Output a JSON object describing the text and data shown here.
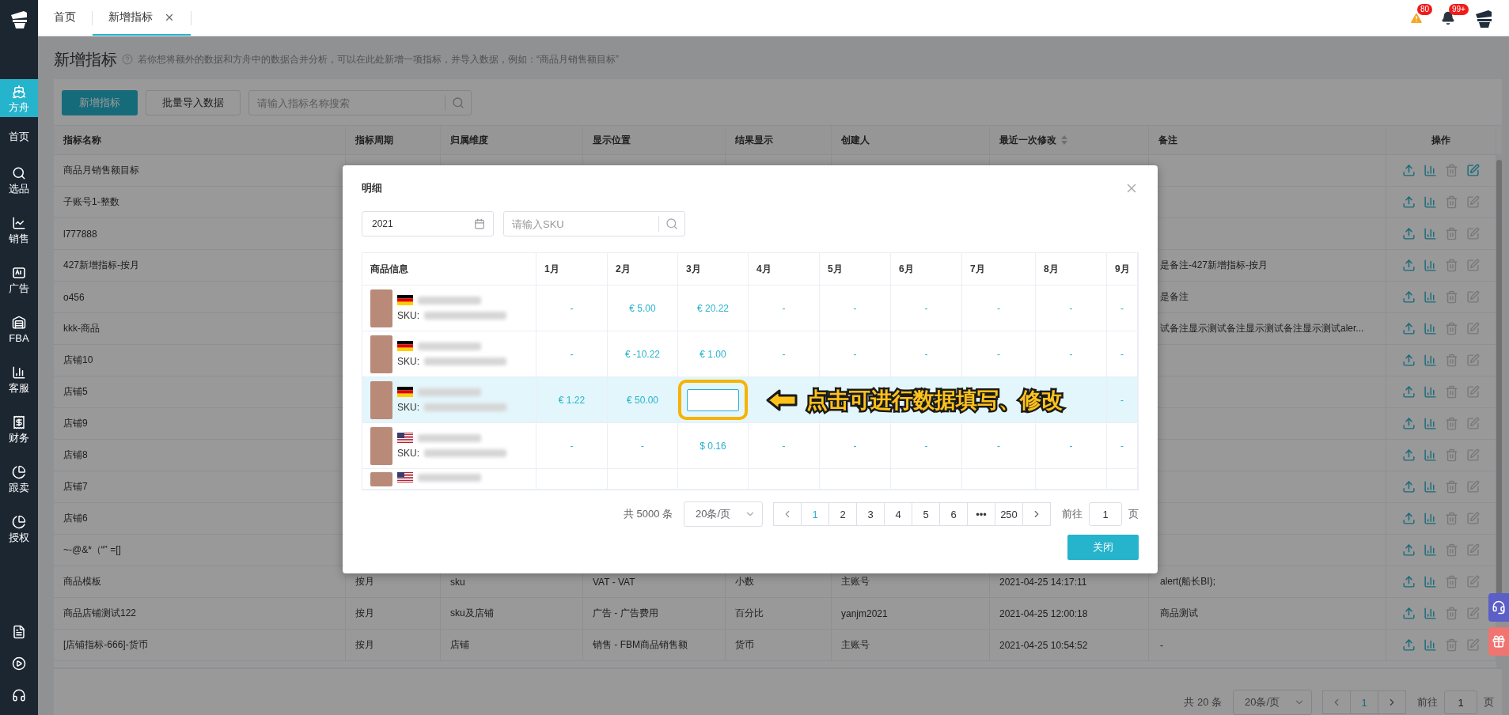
{
  "topbar": {
    "tabs": [
      {
        "label": "首页",
        "selected": false,
        "closable": false
      },
      {
        "label": "新增指标",
        "selected": true,
        "closable": true
      }
    ],
    "warning_count": "80",
    "notification_count": "99+"
  },
  "sidebar": {
    "items": [
      {
        "label": "方舟",
        "selected": true
      },
      {
        "label": "首页",
        "selected": false
      },
      {
        "label": "选品",
        "selected": false
      },
      {
        "label": "销售",
        "selected": false
      },
      {
        "label": "广告",
        "selected": false
      },
      {
        "label": "FBA",
        "selected": false
      },
      {
        "label": "客服",
        "selected": false
      },
      {
        "label": "财务",
        "selected": false
      },
      {
        "label": "跟卖",
        "selected": false
      },
      {
        "label": "授权",
        "selected": false
      }
    ]
  },
  "page": {
    "title": "新增指标",
    "description": "若你想将额外的数据和方舟中的数据合并分析，可以在此处新增一项指标，并导入数据，例如：“商品月销售额目标”",
    "toolbar": {
      "primary_button": "新增指标",
      "import_button": "批量导入数据",
      "search": {
        "placeholder": "请输入指标名称搜索"
      }
    }
  },
  "table": {
    "columns": [
      {
        "label": "指标名称",
        "sortable": false
      },
      {
        "label": "指标周期",
        "sortable": false
      },
      {
        "label": "归属维度",
        "sortable": false
      },
      {
        "label": "显示位置",
        "sortable": false
      },
      {
        "label": "结果显示",
        "sortable": false
      },
      {
        "label": "创建人",
        "sortable": false
      },
      {
        "label": "最近一次修改",
        "sortable": true
      },
      {
        "label": "备注",
        "sortable": false
      },
      {
        "label": "操作",
        "sortable": false
      }
    ],
    "rows": [
      {
        "name": "商品月销售额目标",
        "edit_enabled": true,
        "delete_enabled": false
      },
      {
        "name": "子账号1-整数",
        "edit_enabled": false,
        "delete_enabled": false
      },
      {
        "name": "l777888",
        "edit_enabled": false,
        "delete_enabled": false
      },
      {
        "name": "427新增指标-按月",
        "note": "是备注-427新增指标-按月",
        "edit_enabled": false,
        "delete_enabled": false
      },
      {
        "name": "o456",
        "note": "是备注",
        "edit_enabled": false,
        "delete_enabled": false
      },
      {
        "name": "kkk-商品",
        "note": "试备注显示测试备注显示测试备注显示测试aler...",
        "edit_enabled": false,
        "delete_enabled": false
      },
      {
        "name": "店铺10",
        "edit_enabled": false,
        "delete_enabled": false
      },
      {
        "name": "店铺5",
        "edit_enabled": false,
        "delete_enabled": false
      },
      {
        "name": "店铺9",
        "edit_enabled": false,
        "delete_enabled": false
      },
      {
        "name": "店铺8",
        "edit_enabled": false,
        "delete_enabled": false
      },
      {
        "name": "店铺7",
        "edit_enabled": false,
        "delete_enabled": false
      },
      {
        "name": "店铺6",
        "edit_enabled": false,
        "delete_enabled": false
      },
      {
        "name": "~-@&*（“” =[]",
        "edit_enabled": false,
        "delete_enabled": false
      },
      {
        "name": "商品模板",
        "details": [
          "按月",
          "sku",
          "VAT - VAT",
          "小数",
          "主账号",
          "2021-04-25 14:17:11"
        ],
        "note": "alert(船长BI);",
        "edit_enabled": false,
        "delete_enabled": false
      },
      {
        "name": "商品店铺测试122",
        "details": [
          "按月",
          "sku及店铺",
          "广告 - 广告费用",
          "百分比",
          "yanjm2021",
          "2021-04-25 12:00:18"
        ],
        "note": "商品测试",
        "edit_enabled": false,
        "delete_enabled": false
      },
      {
        "name": "[店铺指标-666]-货币",
        "details": [
          "按月",
          "店铺",
          "销售 - FBM商品销售额",
          "货币",
          "主账号",
          "2021-04-25 10:54:52"
        ],
        "note": "-",
        "edit_enabled": false,
        "delete_enabled": false
      }
    ],
    "pagination": {
      "total": "共 20 条",
      "page_size": "20条/页",
      "pages": [
        {
          "label": "1",
          "selected": true
        }
      ],
      "goto_label": "前往",
      "goto_value": "1",
      "page_unit": "页"
    }
  },
  "modal": {
    "title": "明细",
    "year": "2021",
    "sku_search": {
      "placeholder": "请输入SKU"
    },
    "columns": [
      "商品信息",
      "1月",
      "2月",
      "3月",
      "4月",
      "5月",
      "6月",
      "7月",
      "8月",
      "9月"
    ],
    "rows": [
      {
        "kind": "de",
        "selected": false,
        "sku_label": "SKU:",
        "cells": [
          {
            "kind": "text",
            "value": "-"
          },
          {
            "kind": "text",
            "value": "€ 5.00"
          },
          {
            "kind": "text",
            "value": "€ 20.22"
          },
          {
            "kind": "text",
            "value": "-"
          },
          {
            "kind": "text",
            "value": "-"
          },
          {
            "kind": "text",
            "value": "-"
          },
          {
            "kind": "text",
            "value": "-"
          },
          {
            "kind": "text",
            "value": "-"
          },
          {
            "kind": "text",
            "value": "-"
          }
        ]
      },
      {
        "kind": "de",
        "selected": false,
        "sku_label": "SKU:",
        "cells": [
          {
            "kind": "text",
            "value": "-"
          },
          {
            "kind": "text",
            "value": "€ -10.22"
          },
          {
            "kind": "text",
            "value": "€ 1.00"
          },
          {
            "kind": "text",
            "value": "-"
          },
          {
            "kind": "text",
            "value": "-"
          },
          {
            "kind": "text",
            "value": "-"
          },
          {
            "kind": "text",
            "value": "-"
          },
          {
            "kind": "text",
            "value": "-"
          },
          {
            "kind": "text",
            "value": "-"
          }
        ]
      },
      {
        "kind": "de",
        "selected": true,
        "sku_label": "SKU:",
        "cells": [
          {
            "kind": "text",
            "value": "€ 1.22"
          },
          {
            "kind": "text",
            "value": "€ 50.00"
          },
          {
            "kind": "input"
          },
          {
            "kind": "covered"
          },
          {
            "kind": "covered"
          },
          {
            "kind": "covered"
          },
          {
            "kind": "covered"
          },
          {
            "kind": "covered"
          },
          {
            "kind": "text",
            "value": "-"
          }
        ]
      },
      {
        "kind": "us",
        "selected": false,
        "sku_label": "SKU:",
        "cells": [
          {
            "kind": "text",
            "value": "-"
          },
          {
            "kind": "text",
            "value": "-"
          },
          {
            "kind": "text",
            "value": "$ 0.16"
          },
          {
            "kind": "text",
            "value": "-"
          },
          {
            "kind": "text",
            "value": "-"
          },
          {
            "kind": "text",
            "value": "-"
          },
          {
            "kind": "text",
            "value": "-"
          },
          {
            "kind": "text",
            "value": "-"
          },
          {
            "kind": "text",
            "value": "-"
          }
        ]
      }
    ],
    "clipped_row": {
      "kind": "us"
    },
    "annotation": {
      "text": "点击可进行数据填写、修改"
    },
    "pagination": {
      "total": "共 5000 条",
      "page_size": "20条/页",
      "pages": [
        {
          "label": "1",
          "selected": true
        },
        {
          "label": "2",
          "selected": false
        },
        {
          "label": "3",
          "selected": false
        },
        {
          "label": "4",
          "selected": false
        },
        {
          "label": "5",
          "selected": false
        },
        {
          "label": "6",
          "selected": false
        },
        {
          "label": "•••",
          "selected": false
        },
        {
          "label": "250",
          "selected": false
        }
      ],
      "goto_label": "前往",
      "goto_value": "1",
      "page_unit": "页"
    },
    "close_button": "关闭"
  }
}
